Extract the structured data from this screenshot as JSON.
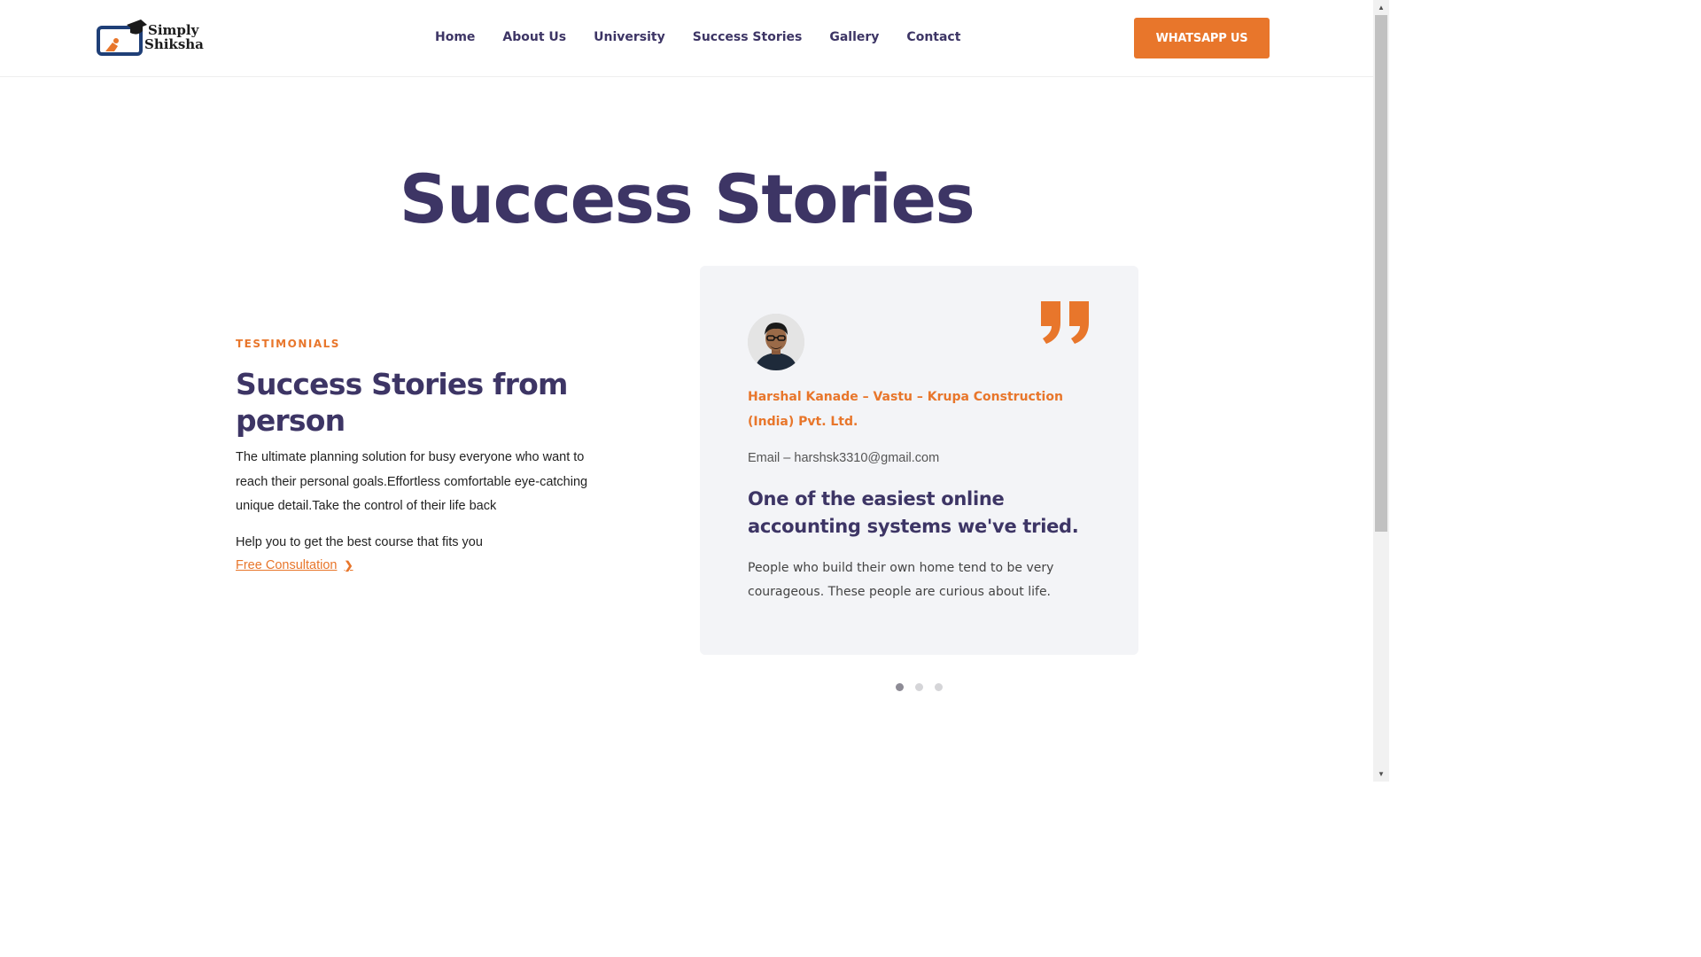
{
  "header": {
    "logo": {
      "line1": "Simply",
      "line2": "Shiksha"
    },
    "nav": [
      "Home",
      "About Us",
      "University",
      "Success Stories",
      "Gallery",
      "Contact"
    ],
    "cta_label": "WHATSAPP US"
  },
  "page": {
    "title": "Success Stories"
  },
  "testimonials_intro": {
    "eyebrow": "TESTIMONIALS",
    "heading": "Success Stories from person",
    "description": "The ultimate planning solution for busy everyone who want to reach their personal goals.Effortless comfortable eye-catching unique detail.Take the control of their life back",
    "help_text": "Help you to get the best course that fits you",
    "link_label": "Free Consultation"
  },
  "testimonial_card": {
    "name": "Harshal Kanade – Vastu – Krupa Construction (India) Pvt. Ltd.",
    "email": "Email – harshsk3310@gmail.com",
    "headline": "One of the easiest online accounting systems we've tried.",
    "body": "People who build their own home tend to be very courageous. These people are curious about life."
  },
  "carousel": {
    "pages": 3,
    "active": 1
  },
  "colors": {
    "accent": "#e8762b",
    "heading": "#3d3565",
    "card_bg": "#f3f4f7"
  },
  "icons": [
    "logo-icon",
    "quote-icon",
    "chevron-right-icon",
    "avatar-photo"
  ]
}
